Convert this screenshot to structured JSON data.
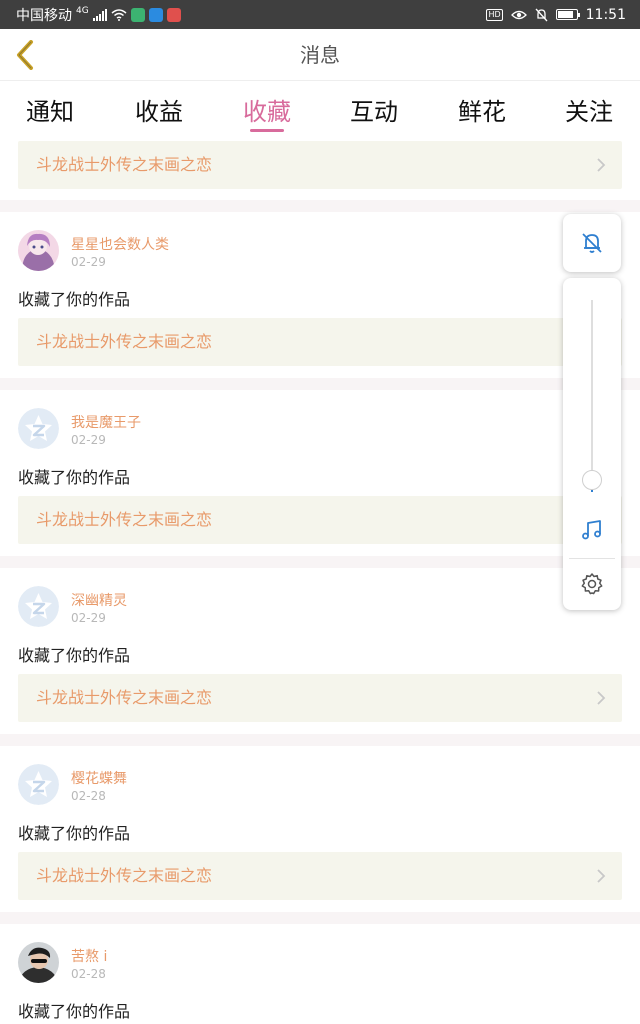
{
  "status_bar": {
    "carrier": "中国移动",
    "network": "4G",
    "time": "11:51",
    "hd": "HD",
    "battery_percent": 85
  },
  "header": {
    "title": "消息",
    "back_icon": "chevron-left-icon",
    "accent_color": "#c9a227"
  },
  "tabs": [
    {
      "label": "通知"
    },
    {
      "label": "收益"
    },
    {
      "label": "收藏"
    },
    {
      "label": "互动"
    },
    {
      "label": "鲜花"
    },
    {
      "label": "关注"
    }
  ],
  "active_tab_color": "#d86b9c",
  "top_work": "斗龙战士外传之末画之恋",
  "items": [
    {
      "username": "星星也会数人类",
      "date": "02-29",
      "action": "收藏了你的作品",
      "work": "斗龙战士外传之末画之恋",
      "avatar": "anime-avatar"
    },
    {
      "username": "我是魔王子",
      "date": "02-29",
      "action": "收藏了你的作品",
      "work": "斗龙战士外传之末画之恋",
      "avatar": "default-star-avatar"
    },
    {
      "username": "深幽精灵",
      "date": "02-29",
      "action": "收藏了你的作品",
      "work": "斗龙战士外传之末画之恋",
      "avatar": "default-star-avatar"
    },
    {
      "username": "樱花蝶舞",
      "date": "02-28",
      "action": "收藏了你的作品",
      "work": "斗龙战士外传之末画之恋",
      "avatar": "default-star-avatar"
    },
    {
      "username": "苦熬 i",
      "date": "02-28",
      "action": "收藏了你的作品",
      "work": "",
      "avatar": "photo-avatar"
    }
  ],
  "volume_panel": {
    "bell_icon": "bell-off-icon",
    "music_icon": "music-note-icon",
    "settings_icon": "gear-icon",
    "volume_level": 0
  }
}
